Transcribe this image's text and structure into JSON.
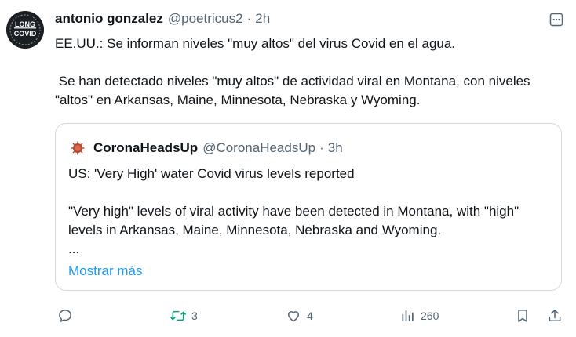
{
  "tweet": {
    "author_name": "antonio gonzalez",
    "author_handle": "@poetricus2",
    "separator": "·",
    "time": "2h",
    "avatar_text_top": "LONG",
    "avatar_text_bottom": "COVID",
    "paragraphs": [
      "EE.UU.: Se informan niveles \"muy altos\" del virus Covid en el agua.",
      " Se han detectado niveles \"muy altos\" de actividad viral en Montana, con niveles \"altos\" en Arkansas, Maine, Minnesota, Nebraska y Wyoming."
    ]
  },
  "quote": {
    "author_name": "CoronaHeadsUp",
    "author_handle": "@CoronaHeadsUp",
    "separator": "·",
    "time": "3h",
    "paragraphs": [
      "US: 'Very High' water Covid virus levels reported",
      "\"Very high\" levels of viral activity have been detected in Montana, with \"high\" levels in Arkansas, Maine, Minnesota, Nebraska and Wyoming."
    ],
    "ellipsis": "...",
    "show_more": "Mostrar más"
  },
  "actions": {
    "reply_count": "",
    "retweet_count": "3",
    "like_count": "4",
    "views_count": "260"
  },
  "icons": {
    "more": "more-horizontal-icon",
    "reply": "reply-icon",
    "retweet": "retweet-icon",
    "like": "heart-icon",
    "views": "views-icon",
    "bookmark": "bookmark-icon",
    "share": "share-icon"
  },
  "colors": {
    "text": "#0f1419",
    "secondary": "#536471",
    "link": "#1d9bf0",
    "border": "#cfd9de",
    "retweet_icon": "#00a37a"
  }
}
